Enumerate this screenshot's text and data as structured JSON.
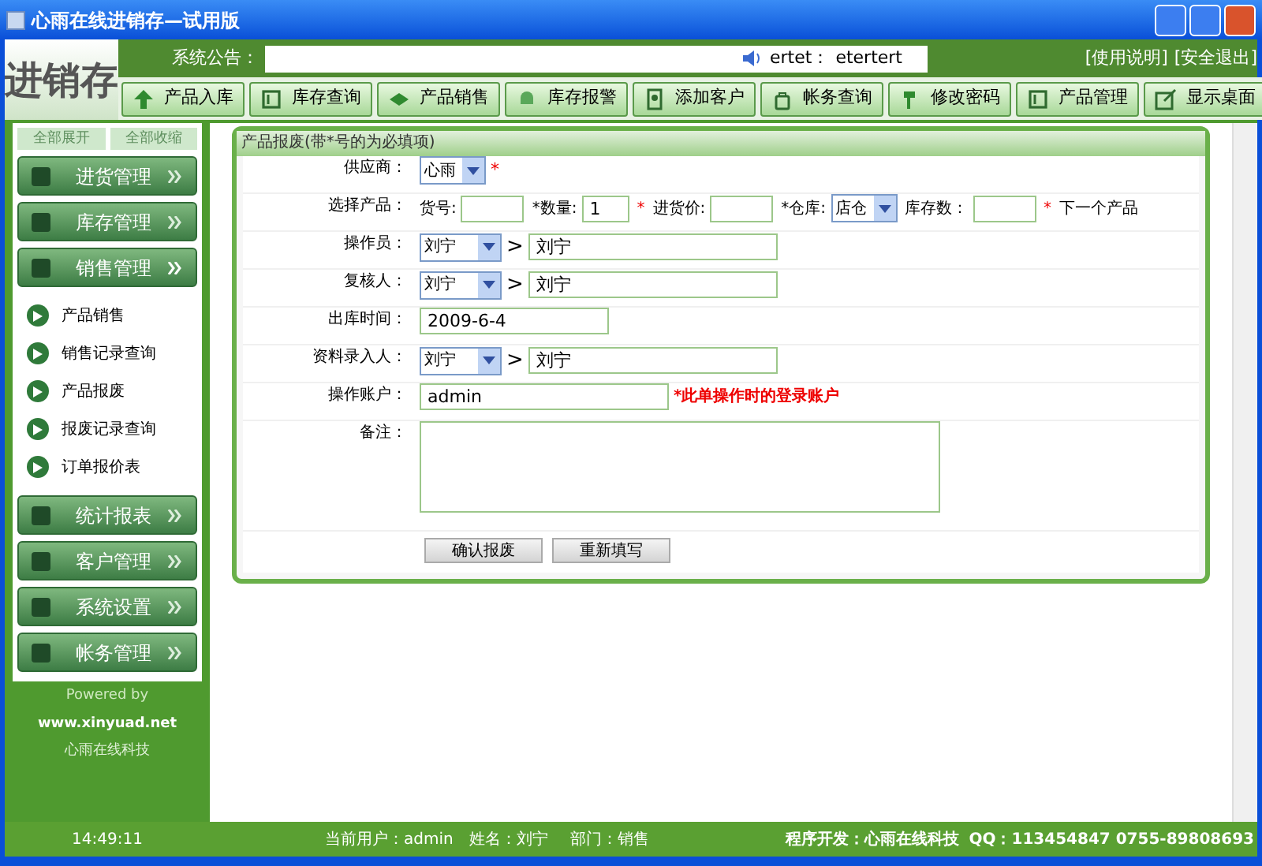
{
  "window": {
    "title": "心雨在线进销存—试用版"
  },
  "logo": "进销存",
  "notice": {
    "label": "系统公告：",
    "speaker": "ertet：",
    "message": "etertert"
  },
  "header_links": [
    "[使用说明]",
    "[安全退出]"
  ],
  "toolbar": [
    {
      "label": "产品入库"
    },
    {
      "label": "库存查询"
    },
    {
      "label": "产品销售"
    },
    {
      "label": "库存报警"
    },
    {
      "label": "添加客户"
    },
    {
      "label": "帐务查询"
    },
    {
      "label": "修改密码"
    },
    {
      "label": "产品管理"
    },
    {
      "label": "显示桌面"
    }
  ],
  "sidebar": {
    "top_buttons": [
      "全部展开",
      "全部收缩"
    ],
    "groups": [
      {
        "label": "进货管理",
        "expanded": false
      },
      {
        "label": "库存管理",
        "expanded": false
      },
      {
        "label": "销售管理",
        "expanded": true,
        "children": [
          {
            "label": "产品销售"
          },
          {
            "label": "销售记录查询"
          },
          {
            "label": "产品报废"
          },
          {
            "label": "报废记录查询"
          },
          {
            "label": "订单报价表"
          }
        ]
      },
      {
        "label": "统计报表",
        "expanded": false
      },
      {
        "label": "客户管理",
        "expanded": false
      },
      {
        "label": "系统设置",
        "expanded": false
      },
      {
        "label": "帐务管理",
        "expanded": false
      }
    ],
    "powered": "Powered by",
    "site": "www.xinyuad.net",
    "company": "心雨在线科技"
  },
  "form": {
    "title": "产品报废(带*号的为必填项)",
    "rows": [
      {
        "kind": "select",
        "label": "供应商：",
        "select": "心雨",
        "required": "*"
      },
      {
        "kind": "product",
        "label": "选择产品：",
        "parts": [
          {
            "kind": "text",
            "label": "货号:"
          },
          {
            "kind": "text",
            "label": "*数量:",
            "value": "1",
            "after": "*"
          },
          {
            "kind": "text",
            "label": "进货价:"
          },
          {
            "kind": "select",
            "label": "*仓库:",
            "value": "店仓"
          },
          {
            "kind": "text",
            "label": "库存数：",
            "after": "*"
          }
        ],
        "link": "下一个产品"
      },
      {
        "kind": "pair",
        "label": "操作员：",
        "select": "刘宁",
        "sep": ">",
        "value": "刘宁"
      },
      {
        "kind": "pair",
        "label": "复核人：",
        "select": "刘宁",
        "sep": ">",
        "value": "刘宁"
      },
      {
        "kind": "input",
        "label": "出库时间：",
        "value": "2009-6-4"
      },
      {
        "kind": "pair",
        "label": "资料录入人：",
        "select": "刘宁",
        "sep": ">",
        "value": "刘宁"
      },
      {
        "kind": "input",
        "label": "操作账户：",
        "value": "admin",
        "note": "*此单操作时的登录账户"
      },
      {
        "kind": "textarea",
        "label": "备注："
      }
    ],
    "buttons": [
      "确认报废",
      "重新填写"
    ]
  },
  "status_bar": {
    "time": "14:49:11",
    "user": "当前用户：admin",
    "name": "姓名：刘宁",
    "dept": "部门：销售",
    "developer": "程序开发：心雨在线科技",
    "contact": "QQ：113454847 0755-89808693"
  }
}
